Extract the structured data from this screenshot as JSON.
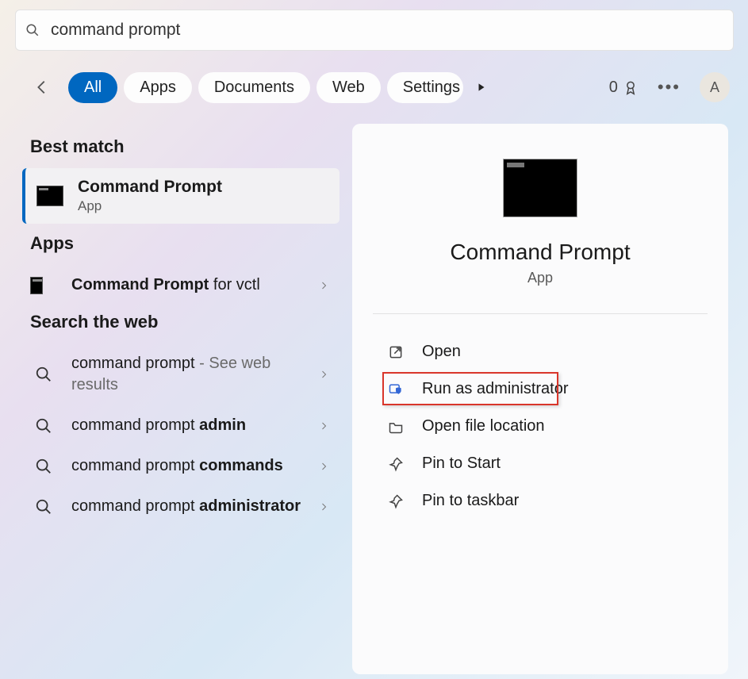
{
  "search": {
    "value": "command prompt"
  },
  "tabs": {
    "items": [
      "All",
      "Apps",
      "Documents",
      "Web",
      "Settings"
    ],
    "active_index": 0
  },
  "header_right": {
    "score": "0",
    "avatar_letter": "A"
  },
  "left": {
    "best_match_header": "Best match",
    "best_match": {
      "title": "Command Prompt",
      "subtitle": "App"
    },
    "apps_header": "Apps",
    "apps": [
      {
        "bold": "Command Prompt",
        "rest": " for vctl"
      }
    ],
    "web_header": "Search the web",
    "web": [
      {
        "pre": "command prompt",
        "light": " - See web results",
        "bold_after": ""
      },
      {
        "pre": "command prompt ",
        "light": "",
        "bold_after": "admin"
      },
      {
        "pre": "command prompt ",
        "light": "",
        "bold_after": "commands"
      },
      {
        "pre": "command prompt ",
        "light": "",
        "bold_after": "administrator"
      }
    ]
  },
  "right": {
    "title": "Command Prompt",
    "subtitle": "App",
    "actions": [
      {
        "icon": "open-icon",
        "label": "Open"
      },
      {
        "icon": "shield-icon",
        "label": "Run as administrator",
        "highlighted": true
      },
      {
        "icon": "folder-icon",
        "label": "Open file location"
      },
      {
        "icon": "pin-icon",
        "label": "Pin to Start"
      },
      {
        "icon": "pin-icon",
        "label": "Pin to taskbar"
      }
    ]
  }
}
